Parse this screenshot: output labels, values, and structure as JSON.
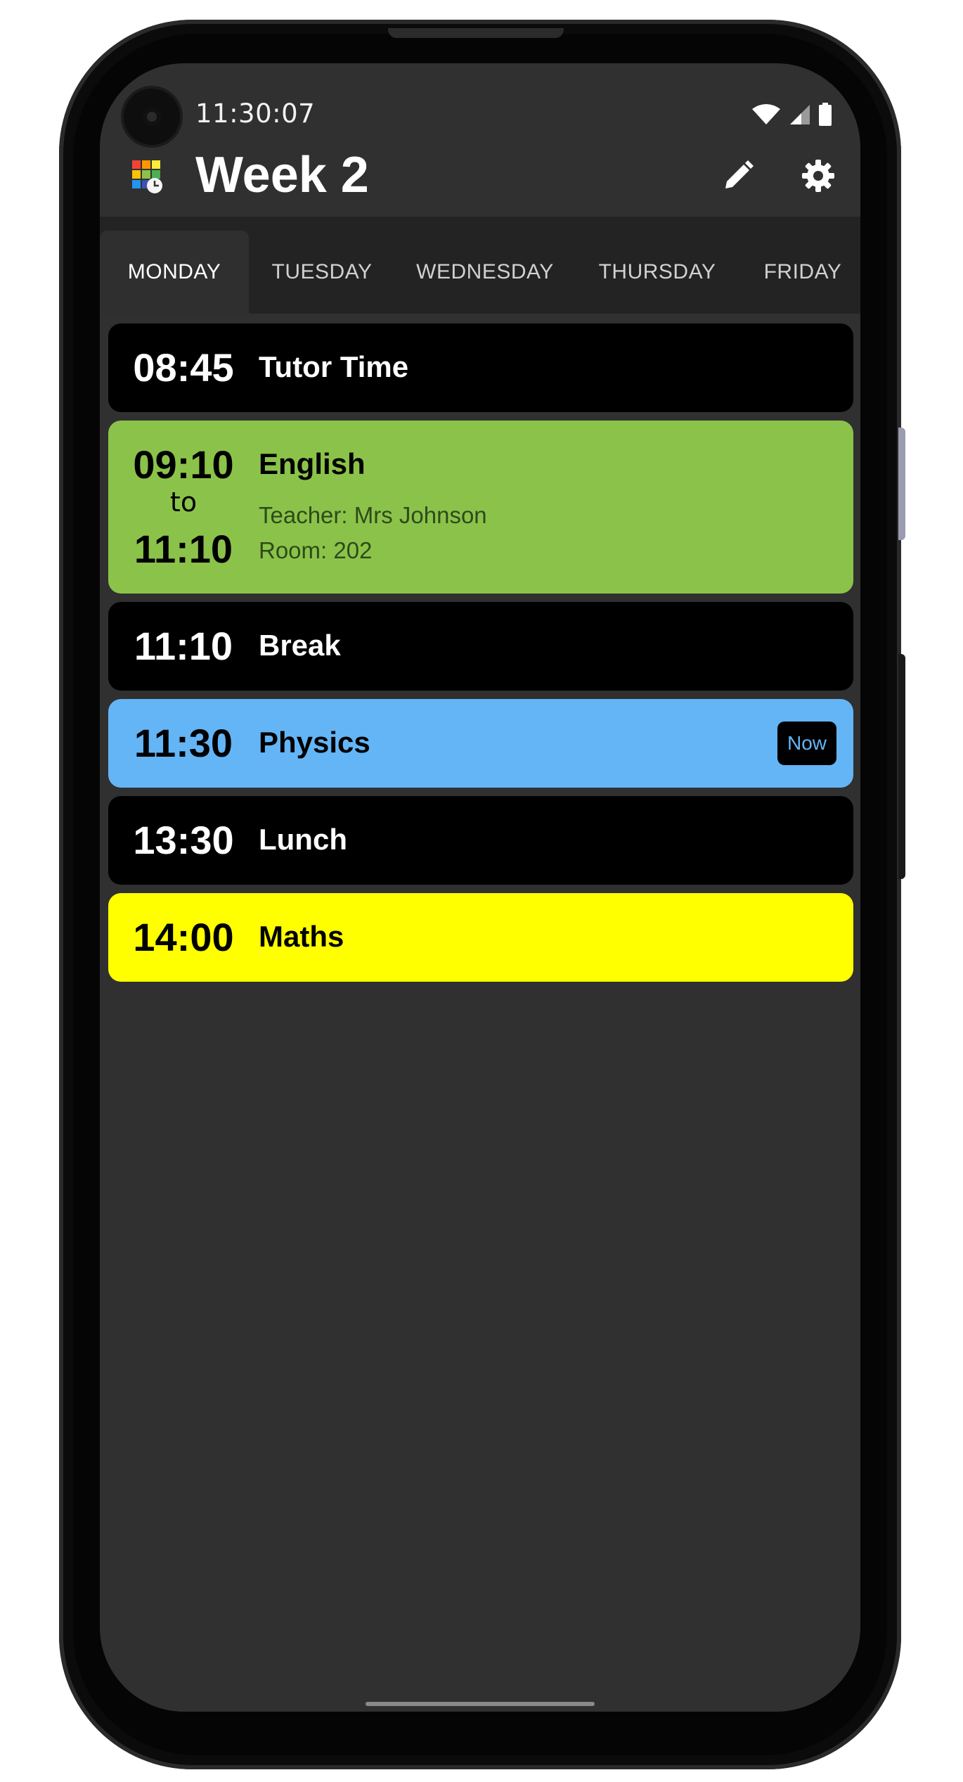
{
  "status_bar": {
    "time": "11:30:07"
  },
  "app_bar": {
    "title": "Week 2"
  },
  "tabs": [
    "MONDAY",
    "TUESDAY",
    "WEDNESDAY",
    "THURSDAY",
    "FRIDAY"
  ],
  "active_tab": "MONDAY",
  "lessons": [
    {
      "time": "08:45",
      "subject": "Tutor Time",
      "color": "#000000",
      "text_color": "#ffffff"
    },
    {
      "start": "09:10",
      "to": "to",
      "end": "11:10",
      "subject": "English",
      "teacher": "Teacher: Mrs Johnson",
      "room": "Room: 202",
      "color": "#8bc34a",
      "text_color": "#000000"
    },
    {
      "time": "11:10",
      "subject": "Break",
      "color": "#000000",
      "text_color": "#ffffff"
    },
    {
      "time": "11:30",
      "subject": "Physics",
      "badge": "Now",
      "color": "#64b5f6",
      "text_color": "#000000"
    },
    {
      "time": "13:30",
      "subject": "Lunch",
      "color": "#000000",
      "text_color": "#ffffff"
    },
    {
      "time": "14:00",
      "subject": "Maths",
      "color": "#ffff00",
      "text_color": "#000000"
    }
  ],
  "icons": {
    "wifi": "wifi-icon",
    "signal": "signal-icon",
    "battery": "battery-icon",
    "edit": "pencil-icon",
    "settings": "gear-icon",
    "logo": "app-logo-icon"
  }
}
